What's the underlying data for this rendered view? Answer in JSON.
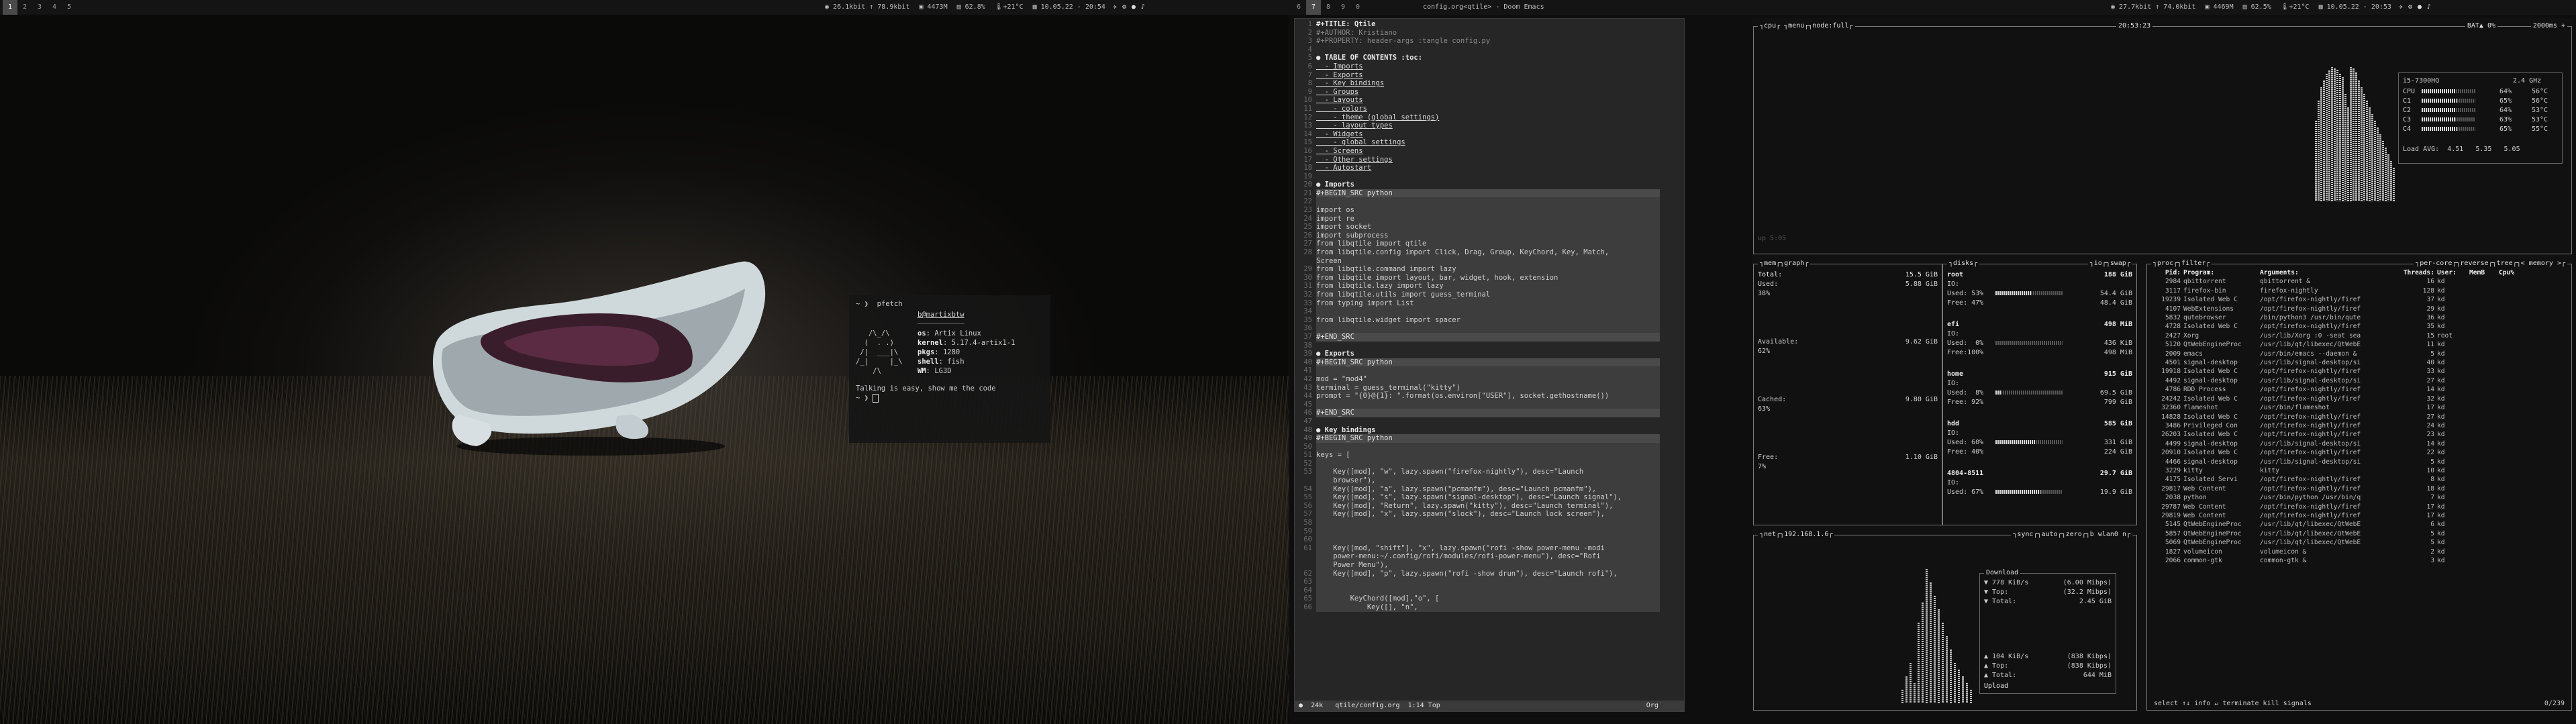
{
  "top_bar_left": {
    "workspaces": [
      "1",
      "2",
      "3",
      "4",
      "5"
    ],
    "active_workspace": "1",
    "clock_partial": "",
    "net": "26.1kbit ↑ 78.9kbit",
    "cpu": "4473M",
    "mem": "62.8%",
    "temp": "+21°C",
    "date": "10.05.22 - 20:54"
  },
  "top_bar_right": {
    "workspaces": [
      "6",
      "7",
      "8",
      "9",
      "0"
    ],
    "active_workspace": "7",
    "window_title": "config.org<qtile> - Doom Emacs",
    "net": "27.7kbit ↑ 74.0kbit",
    "cpu": "4469M",
    "mem": "62.5%",
    "temp": "+21°C",
    "date": "10.05.22 - 20:53"
  },
  "pfetch": {
    "prompt_cmd": "~ ❯  pfetch",
    "user": "b@martixbtw",
    "logo": [
      "   /\\_/\\",
      "  (  . .)",
      " /|  ___|\\",
      "/_|     |_\\",
      "    /\\"
    ],
    "fields": [
      {
        "key": "os",
        "value": "Artix Linux"
      },
      {
        "key": "kernel",
        "value": "5.17.4-artix1-1"
      },
      {
        "key": "pkgs",
        "value": "1280"
      },
      {
        "key": "shell",
        "value": "fish"
      },
      {
        "key": "WM",
        "value": "LG3D"
      }
    ],
    "quote": "Talking is easy, show me the code",
    "prompt2": "~ ❯"
  },
  "emacs": {
    "lines": [
      {
        "n": "1",
        "t": "#+TITLE: Qtile",
        "c": "h"
      },
      {
        "n": "2",
        "t": "#+AUTHOR: Kristiano",
        "c": "dim"
      },
      {
        "n": "3",
        "t": "#+PROPERTY: header-args :tangle config.py",
        "c": "dim"
      },
      {
        "n": "4",
        "t": "",
        "c": ""
      },
      {
        "n": "5",
        "t": "● TABLE OF CONTENTS :toc:",
        "c": "h"
      },
      {
        "n": "6",
        "t": "  - Imports",
        "c": "lnk"
      },
      {
        "n": "7",
        "t": "  - Exports",
        "c": "lnk"
      },
      {
        "n": "8",
        "t": "  - Key bindings",
        "c": "lnk"
      },
      {
        "n": "9",
        "t": "  - Groups",
        "c": "lnk"
      },
      {
        "n": "10",
        "t": "  - Layouts",
        "c": "lnk"
      },
      {
        "n": "11",
        "t": "    - colors",
        "c": "lnk"
      },
      {
        "n": "12",
        "t": "    - theme (global settings)",
        "c": "lnk"
      },
      {
        "n": "13",
        "t": "    - layout types",
        "c": "lnk"
      },
      {
        "n": "14",
        "t": "  - Widgets",
        "c": "lnk"
      },
      {
        "n": "15",
        "t": "    - global settings",
        "c": "lnk"
      },
      {
        "n": "16",
        "t": "  - Screens",
        "c": "lnk"
      },
      {
        "n": "17",
        "t": "  - Other settings",
        "c": "lnk"
      },
      {
        "n": "18",
        "t": "  - Autostart",
        "c": "lnk"
      },
      {
        "n": "19",
        "t": "",
        "c": ""
      },
      {
        "n": "20",
        "t": "● Imports",
        "c": "h"
      },
      {
        "n": "21",
        "t": "#+BEGIN_SRC python",
        "c": "blk"
      },
      {
        "n": "22",
        "t": "",
        "c": "src"
      },
      {
        "n": "23",
        "t": "import os",
        "c": "src"
      },
      {
        "n": "24",
        "t": "import re",
        "c": "src"
      },
      {
        "n": "25",
        "t": "import socket",
        "c": "src"
      },
      {
        "n": "26",
        "t": "import subprocess",
        "c": "src"
      },
      {
        "n": "27",
        "t": "from libqtile import qtile",
        "c": "src"
      },
      {
        "n": "28",
        "t": "from libqtile.config import Click, Drag, Group, KeyChord, Key, Match,",
        "c": "src"
      },
      {
        "n": "",
        "t": "Screen",
        "c": "src"
      },
      {
        "n": "29",
        "t": "from libqtile.command import lazy",
        "c": "src"
      },
      {
        "n": "30",
        "t": "from libqtile import layout, bar, widget, hook, extension",
        "c": "src"
      },
      {
        "n": "31",
        "t": "from libqtile.lazy import lazy",
        "c": "src"
      },
      {
        "n": "32",
        "t": "from libqtile.utils import guess_terminal",
        "c": "src"
      },
      {
        "n": "33",
        "t": "from typing import List",
        "c": "src"
      },
      {
        "n": "34",
        "t": "",
        "c": "src"
      },
      {
        "n": "35",
        "t": "from libqtile.widget import spacer",
        "c": "src"
      },
      {
        "n": "36",
        "t": "",
        "c": "src"
      },
      {
        "n": "37",
        "t": "#+END_SRC",
        "c": "blk"
      },
      {
        "n": "38",
        "t": "",
        "c": ""
      },
      {
        "n": "39",
        "t": "● Exports",
        "c": "h"
      },
      {
        "n": "40",
        "t": "#+BEGIN_SRC python",
        "c": "blk"
      },
      {
        "n": "41",
        "t": "",
        "c": "src"
      },
      {
        "n": "42",
        "t": "mod = \"mod4\"",
        "c": "src"
      },
      {
        "n": "43",
        "t": "terminal = guess_terminal(\"kitty\")",
        "c": "src"
      },
      {
        "n": "44",
        "t": "prompt = \"{0}@{1}: \".format(os.environ[\"USER\"], socket.gethostname())",
        "c": "src"
      },
      {
        "n": "45",
        "t": "",
        "c": "src"
      },
      {
        "n": "46",
        "t": "#+END_SRC",
        "c": "blk"
      },
      {
        "n": "47",
        "t": "",
        "c": ""
      },
      {
        "n": "48",
        "t": "● Key bindings",
        "c": "h"
      },
      {
        "n": "49",
        "t": "#+BEGIN_SRC python",
        "c": "blk"
      },
      {
        "n": "50",
        "t": "",
        "c": "src"
      },
      {
        "n": "51",
        "t": "keys = [",
        "c": "src"
      },
      {
        "n": "52",
        "t": "",
        "c": "src"
      },
      {
        "n": "53",
        "t": "    Key([mod], \"w\", lazy.spawn(\"firefox-nightly\"), desc=\"Launch",
        "c": "src"
      },
      {
        "n": "",
        "t": "    browser\"),",
        "c": "src"
      },
      {
        "n": "54",
        "t": "    Key([mod], \"a\", lazy.spawn(\"pcmanfm\"), desc=\"Launch pcmanfm\"),",
        "c": "src"
      },
      {
        "n": "55",
        "t": "    Key([mod], \"s\", lazy.spawn(\"signal-desktop\"), desc=\"Launch signal\"),",
        "c": "src"
      },
      {
        "n": "56",
        "t": "    Key([mod], \"Return\", lazy.spawn(\"kitty\"), desc=\"Launch terminal\"),",
        "c": "src"
      },
      {
        "n": "57",
        "t": "    Key([mod], \"x\", lazy.spawn(\"slock\"), desc=\"Launch lock screen\"),",
        "c": "src"
      },
      {
        "n": "58",
        "t": "",
        "c": "src"
      },
      {
        "n": "59",
        "t": "",
        "c": "src"
      },
      {
        "n": "60",
        "t": "",
        "c": "src"
      },
      {
        "n": "61",
        "t": "    Key([mod, \"shift\"], \"x\", lazy.spawn(\"rofi -show power-menu -modi",
        "c": "src"
      },
      {
        "n": "",
        "t": "    power-menu:~/.config/rofi/modules/rofi-power-menu\"), desc=\"Rofi",
        "c": "src"
      },
      {
        "n": "",
        "t": "    Power Menu\"),",
        "c": "src"
      },
      {
        "n": "62",
        "t": "    Key([mod], \"p\", lazy.spawn(\"rofi -show drun\"), desc=\"Launch rofi\"),",
        "c": "src"
      },
      {
        "n": "63",
        "t": "",
        "c": "src"
      },
      {
        "n": "64",
        "t": "",
        "c": "src"
      },
      {
        "n": "65",
        "t": "        KeyChord([mod],\"o\", [",
        "c": "src"
      },
      {
        "n": "66",
        "t": "            Key([], \"n\",",
        "c": "src"
      }
    ],
    "modeline": " ●  24k   qtile/config.org  1:14 Top                                                   Org "
  },
  "btop": {
    "cpu": {
      "title": "cpu",
      "tabs": [
        "menu",
        "node:full"
      ],
      "clock": "20:53:23",
      "battery": "BAT▲ 0%",
      "refresh": "2000ms",
      "model": "i5-7300HQ",
      "freq": "2.4 GHz",
      "cores": [
        {
          "name": "CPU",
          "pct": "64%",
          "temp": "56°C",
          "level": 0.64
        },
        {
          "name": "C1",
          "pct": "65%",
          "temp": "56°C",
          "level": 0.65
        },
        {
          "name": "C2",
          "pct": "64%",
          "temp": "53°C",
          "level": 0.64
        },
        {
          "name": "C3",
          "pct": "63%",
          "temp": "53°C",
          "level": 0.63
        },
        {
          "name": "C4",
          "pct": "65%",
          "temp": "55°C",
          "level": 0.65
        }
      ],
      "load": "Load AVG:  4.51   5.35   5.05",
      "uptime": "up 5:05"
    },
    "mem": {
      "title": "mem",
      "tabs": [
        "graph"
      ],
      "total_label": "Total:",
      "total": "15.5 GiB",
      "used_label": "Used:",
      "used": "5.88 GiB",
      "used_pct": "38%",
      "avail_label": "Available:",
      "avail": "9.62 GiB",
      "avail_pct": "62%",
      "cached_label": "Cached:",
      "cached": "9.80 GiB",
      "cached_pct": "63%",
      "free_label": "Free:",
      "free": "1.10 GiB",
      "free_pct": "7%"
    },
    "disks": {
      "title": "disks",
      "tabs": [
        "io",
        "swap"
      ],
      "entries": [
        {
          "name": "root",
          "size": "188 GiB",
          "io": "IO:",
          "used_pct": "Used: 53%",
          "used": "54.4 GiB",
          "free_pct": "Free: 47%",
          "free": "48.4 GiB",
          "used_level": 0.53
        },
        {
          "name": "efi",
          "size": "498 MiB",
          "io": "IO:",
          "used_pct": "Used:  0%",
          "used": "436 KiB",
          "free_pct": "Free:100%",
          "free": "498 MiB",
          "used_level": 0.0
        },
        {
          "name": "home",
          "size": "915 GiB",
          "io": "IO:",
          "used_pct": "Used:  8%",
          "used": "69.5 GiB",
          "free_pct": "Free: 92%",
          "free": "799 GiB",
          "used_level": 0.08
        },
        {
          "name": "hdd",
          "size": "585 GiB",
          "io": "IO:",
          "used_pct": "Used: 60%",
          "used": "331 GiB",
          "free_pct": "Free: 40%",
          "free": "224 GiB",
          "used_level": 0.6
        },
        {
          "name": "4804-8511",
          "size": "29.7 GiB",
          "io": "IO:",
          "used_pct": "Used: 67%",
          "used": "19.9 GiB",
          "free_pct": "",
          "free": "",
          "used_level": 0.67
        }
      ]
    },
    "net": {
      "title": "net",
      "ip": "192.168.1.6",
      "tabs": [
        "sync",
        "auto",
        "zero",
        "b wlan0 n"
      ],
      "download_label": "Download",
      "dl_rate": "▼ 778 KiB/s",
      "dl_bps": "(6.00 Mibps)",
      "dl_top": "▼ Top:",
      "dl_top_val": "(32.2 Mibps)",
      "dl_total": "▼ Total:",
      "dl_total_val": "2.45 GiB",
      "up_rate": "▲ 104 KiB/s",
      "up_bps": "(838 Kibps)",
      "up_top": "▲ Top:",
      "up_top_val": "(838 Kibps)",
      "up_total": "▲ Total:",
      "up_total_val": "644 MiB",
      "upload_label": "Upload"
    },
    "proc": {
      "title": "proc",
      "filter": "filter",
      "tabs": [
        "per-core",
        "reverse",
        "tree",
        "< memory >"
      ],
      "headers": [
        "Pid:",
        "Program:",
        "Arguments:",
        "Threads:",
        "User:",
        "MemB",
        "Cpu%"
      ],
      "rows": [
        [
          "2984",
          "qbittorrent",
          "qbittorrent &",
          "16",
          "kd",
          "",
          ""
        ],
        [
          "3117",
          "firefox-bin",
          "firefox-nightly",
          "128",
          "kd",
          "",
          ""
        ],
        [
          "19239",
          "Isolated Web C",
          "/opt/firefox-nightly/firef",
          "37",
          "kd",
          "",
          ""
        ],
        [
          "4107",
          "WebExtensions",
          "/opt/firefox-nightly/firef",
          "29",
          "kd",
          "",
          ""
        ],
        [
          "5832",
          "qutebrowser",
          "/bin/python3 /usr/bin/qute",
          "36",
          "kd",
          "",
          ""
        ],
        [
          "4728",
          "Isolated Web C",
          "/opt/firefox-nightly/firef",
          "35",
          "kd",
          "",
          ""
        ],
        [
          "2427",
          "Xorg",
          "/usr/lib/Xorg :0 -seat sea",
          "15",
          "root",
          "",
          ""
        ],
        [
          "5120",
          "QtWebEngineProc",
          "/usr/lib/qt/libexec/QtWebE",
          "11",
          "kd",
          "",
          ""
        ],
        [
          "2009",
          "emacs",
          "/usr/bin/emacs --daemon &",
          "5",
          "kd",
          "",
          ""
        ],
        [
          "4501",
          "signal-desktop",
          "/usr/lib/signal-desktop/si",
          "40",
          "kd",
          "",
          ""
        ],
        [
          "19918",
          "Isolated Web C",
          "/opt/firefox-nightly/firef",
          "33",
          "kd",
          "",
          ""
        ],
        [
          "4492",
          "signal-desktop",
          "/usr/lib/signal-desktop/si",
          "27",
          "kd",
          "",
          ""
        ],
        [
          "4786",
          "RDD Process",
          "/opt/firefox-nightly/firef",
          "14",
          "kd",
          "",
          ""
        ],
        [
          "24242",
          "Isolated Web C",
          "/opt/firefox-nightly/firef",
          "32",
          "kd",
          "",
          ""
        ],
        [
          "32360",
          "flameshot",
          "/usr/bin/flameshot",
          "17",
          "kd",
          "",
          ""
        ],
        [
          "14828",
          "Isolated Web C",
          "/opt/firefox-nightly/firef",
          "27",
          "kd",
          "",
          ""
        ],
        [
          "3486",
          "Privileged Con",
          "/opt/firefox-nightly/firef",
          "24",
          "kd",
          "",
          ""
        ],
        [
          "26203",
          "Isolated Web C",
          "/opt/firefox-nightly/firef",
          "23",
          "kd",
          "",
          ""
        ],
        [
          "4499",
          "signal-desktop",
          "/usr/lib/signal-desktop/si",
          "14",
          "kd",
          "",
          ""
        ],
        [
          "20910",
          "Isolated Web C",
          "/opt/firefox-nightly/firef",
          "22",
          "kd",
          "",
          ""
        ],
        [
          "4466",
          "signal-desktop",
          "/usr/lib/signal-desktop/si",
          "5",
          "kd",
          "",
          ""
        ],
        [
          "3229",
          "kitty",
          "kitty",
          "10",
          "kd",
          "",
          ""
        ],
        [
          "4175",
          "Isolated Servi",
          "/opt/firefox-nightly/firef",
          "8",
          "kd",
          "",
          ""
        ],
        [
          "29817",
          "Web Content",
          "/opt/firefox-nightly/firef",
          "18",
          "kd",
          "",
          ""
        ],
        [
          "2038",
          "python",
          "/usr/bin/python /usr/bin/q",
          "7",
          "kd",
          "",
          ""
        ],
        [
          "29787",
          "Web Content",
          "/opt/firefox-nightly/firef",
          "17",
          "kd",
          "",
          ""
        ],
        [
          "29819",
          "Web Content",
          "/opt/firefox-nightly/firef",
          "17",
          "kd",
          "",
          ""
        ],
        [
          "5145",
          "QtWebEngineProc",
          "/usr/lib/qt/libexec/QtWebE",
          "6",
          "kd",
          "",
          ""
        ],
        [
          "5857",
          "QtWebEngineProc",
          "/usr/lib/qt/libexec/QtWebE",
          "5",
          "kd",
          "",
          ""
        ],
        [
          "5069",
          "QtWebEngineProc",
          "/usr/lib/qt/libexec/QtWebE",
          "5",
          "kd",
          "",
          ""
        ],
        [
          "1827",
          "volumeicon",
          "volumeicon &",
          "2",
          "kd",
          "",
          ""
        ],
        [
          "2066",
          "common-gtk",
          "common-gtk &",
          "3",
          "kd",
          "",
          ""
        ]
      ],
      "footer_left": "select ↑↓ info ↵ terminate kill signals",
      "footer_right": "0/239"
    }
  }
}
